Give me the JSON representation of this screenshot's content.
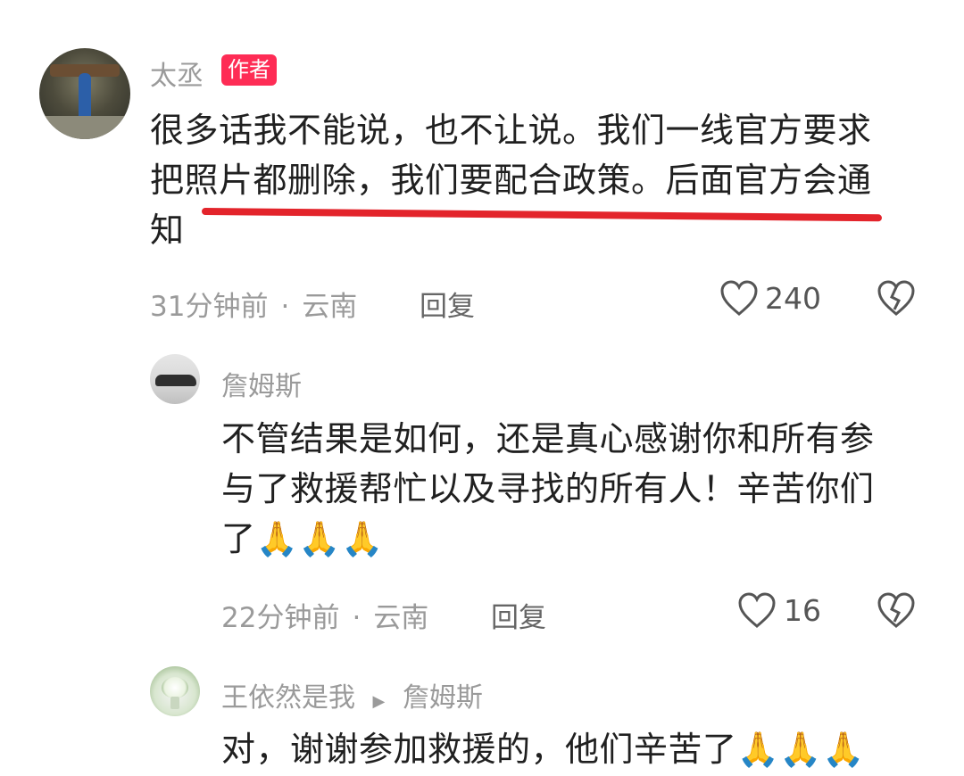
{
  "author_badge": "作者",
  "main_comment": {
    "author": "太丞",
    "lines": [
      "很多话我不能说，也不让说。我们一线官方要求",
      "把照片都删除，我们要配合政策。后面官方会通",
      "知"
    ],
    "time": "31分钟前",
    "location": "云南",
    "reply_label": "回复",
    "likes": "240"
  },
  "reply1": {
    "author": "詹姆斯",
    "lines": [
      "不管结果是如何，还是真心感谢你和所有参",
      "与了救援帮忙以及寻找的所有人！辛苦你们",
      "了🙏🙏🙏"
    ],
    "time": "22分钟前",
    "location": "云南",
    "reply_label": "回复",
    "likes": "16"
  },
  "reply2": {
    "author": "王依然是我",
    "reply_to": "詹姆斯",
    "text": "对，谢谢参加救援的，他们辛苦了🙏🙏🙏"
  },
  "colors": {
    "accent": "#fe2c55",
    "underline": "#e3242b",
    "meta": "#9a9a9a"
  },
  "icons": {
    "like": "heart-outline-icon",
    "dislike": "broken-heart-icon",
    "reply_arrow": "triangle-right-icon"
  }
}
